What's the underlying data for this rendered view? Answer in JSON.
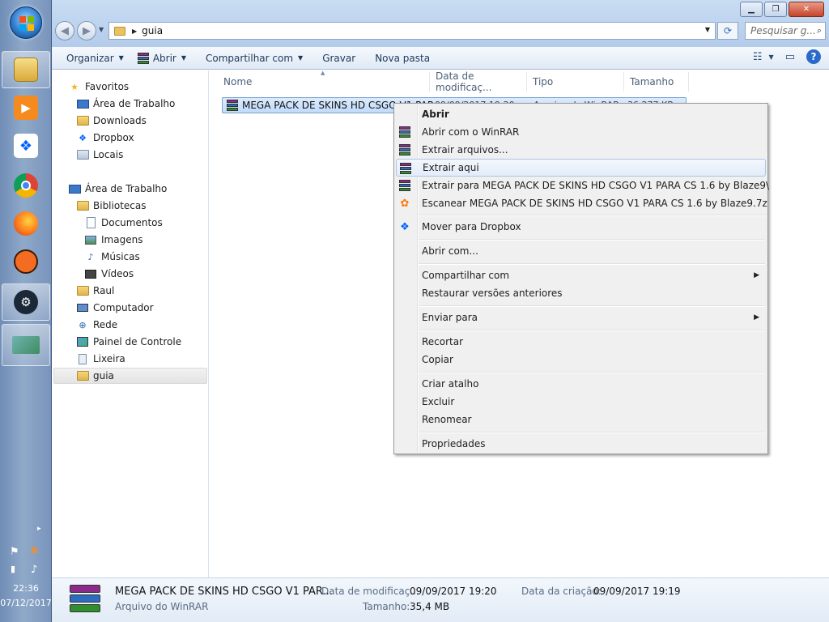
{
  "taskbar": {
    "clock_time": "22:36",
    "clock_date": "07/12/2017",
    "apps": [
      "explorer-icon",
      "media-player-icon",
      "dropbox-icon",
      "chrome-icon",
      "firefox-icon",
      "origin-icon",
      "steam-icon",
      "photo-app-icon"
    ]
  },
  "window": {
    "minimize_glyph": "▁",
    "maximize_glyph": "❐",
    "close_glyph": "✕"
  },
  "address": {
    "path": "guia",
    "search_placeholder": "Pesquisar g..."
  },
  "toolbar": {
    "organize": "Organizar",
    "open": "Abrir",
    "share": "Compartilhar com",
    "burn": "Gravar",
    "new_folder": "Nova pasta"
  },
  "nav": {
    "favorites": "Favoritos",
    "fav_desktop": "Área de Trabalho",
    "downloads": "Downloads",
    "dropbox": "Dropbox",
    "places": "Locais",
    "desktop": "Área de Trabalho",
    "libraries": "Bibliotecas",
    "documents": "Documentos",
    "images": "Imagens",
    "music": "Músicas",
    "videos": "Vídeos",
    "raul": "Raul",
    "computer": "Computador",
    "network": "Rede",
    "control_panel": "Painel de Controle",
    "recycle_bin": "Lixeira",
    "guia": "guia"
  },
  "columns": {
    "name": "Nome",
    "date": "Data de modificaç...",
    "type": "Tipo",
    "size": "Tamanho"
  },
  "file": {
    "name": "MEGA PACK DE SKINS HD CSGO V1 PARA CS 1.6 by Blaze9.7z",
    "name_visible": "MEGA PACK DE SKINS HD CSGO V1 PAR",
    "date": "09/09/2017 19:20",
    "type": "Arquivo do WinRAR",
    "size": "36.277 KB"
  },
  "context_menu": {
    "open": "Abrir",
    "open_winrar": "Abrir com o WinRAR",
    "extract_files": "Extrair arquivos...",
    "extract_here": "Extrair aqui",
    "extract_to": "Extrair para MEGA PACK DE SKINS HD CSGO V1 PARA CS 1.6 by Blaze9\\",
    "scan": "Escanear MEGA PACK DE SKINS HD CSGO V1 PARA CS 1.6 by Blaze9.7z",
    "move_dropbox": "Mover para Dropbox",
    "open_with": "Abrir com...",
    "share_with": "Compartilhar com",
    "restore": "Restaurar versões anteriores",
    "send_to": "Enviar para",
    "cut": "Recortar",
    "copy": "Copiar",
    "create_shortcut": "Criar atalho",
    "delete": "Excluir",
    "rename": "Renomear",
    "properties": "Propriedades"
  },
  "details": {
    "name": "MEGA PACK DE SKINS HD CSGO V1 PAR...",
    "type": "Arquivo do WinRAR",
    "modified_label": "Data de modificaç...",
    "modified_value": "09/09/2017 19:20",
    "size_label": "Tamanho:",
    "size_value": "35,4 MB",
    "created_label": "Data da criação:",
    "created_value": "09/09/2017 19:19"
  },
  "colors": {
    "accent": "#2d6cc1",
    "selection": "#c1dbfc",
    "taskbar": "#7f9cc4"
  }
}
